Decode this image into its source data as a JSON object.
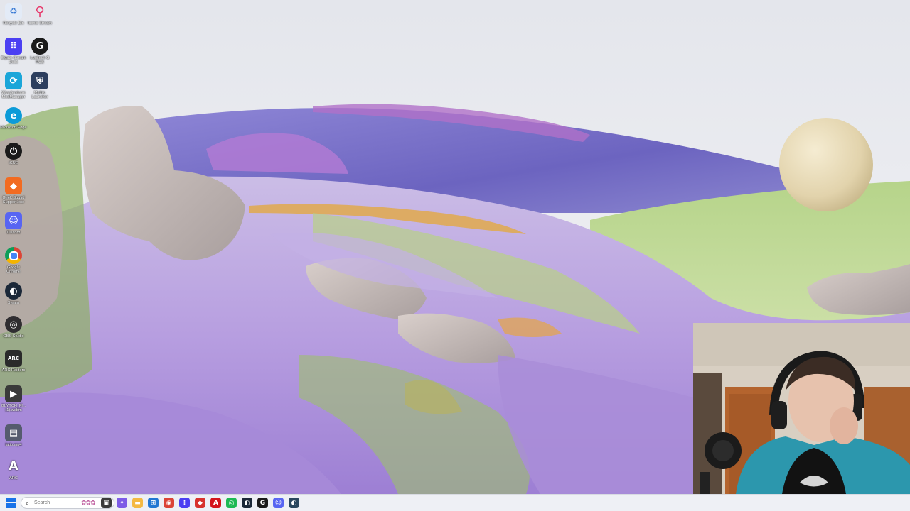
{
  "desktop_icons": [
    {
      "label": "Recycle Bin",
      "icon": "recycle-bin-icon",
      "color": "#dfe8f5"
    },
    {
      "label": "Iconic Stream",
      "icon": "map-pin-icon",
      "color": "#ffffff"
    },
    {
      "label": "Elgato Stream Deck",
      "icon": "stream-deck-icon",
      "color": "#4b3ff2"
    },
    {
      "label": "Logitech G HUB",
      "icon": "logitech-g-icon",
      "color": "#1b1b1b"
    },
    {
      "label": "Wondershare ModManager",
      "icon": "mod-manager-icon",
      "color": "#1ba6d9"
    },
    {
      "label": "Mythic Launcher",
      "icon": "shield-icon",
      "color": "#2c3e5e"
    },
    {
      "label": "Microsoft Edge",
      "icon": "edge-icon",
      "color": "#0c9bd8"
    },
    {
      "label": "iCUE",
      "icon": "icue-icon",
      "color": "#1a1a1a"
    },
    {
      "label": "Geek Squad Support.exe",
      "icon": "geek-squad-icon",
      "color": "#f26b21"
    },
    {
      "label": "Discord",
      "icon": "discord-icon",
      "color": "#5865f2"
    },
    {
      "label": "Google Chrome",
      "icon": "chrome-icon",
      "color": "#db4437"
    },
    {
      "label": "Steam",
      "icon": "steam-icon",
      "color": "#1b2838"
    },
    {
      "label": "OBS Studio",
      "icon": "obs-icon",
      "color": "#302e31"
    },
    {
      "label": "ARC Raiders",
      "icon": "arc-raiders-icon",
      "color": "#2a2a2a"
    },
    {
      "label": "GLYTCH_Fl... (1).webm",
      "icon": "video-file-icon",
      "color": "#3a3a3a"
    },
    {
      "label": "fatio.mp4",
      "icon": "mp4-file-icon",
      "color": "#555b6e"
    },
    {
      "label": "ARC",
      "icon": "arc-letter-icon",
      "color": "#3b3b3b"
    }
  ],
  "taskbar": {
    "search_placeholder": "Search",
    "apps": [
      {
        "name": "task-view",
        "icon": "task-view-icon",
        "color": "#3b3b3b",
        "glyph": "▣"
      },
      {
        "name": "copilot",
        "icon": "copilot-icon",
        "color": "#7d5ce6",
        "glyph": "✦"
      },
      {
        "name": "file-explorer",
        "icon": "folder-icon",
        "color": "#f4b942",
        "glyph": "▬"
      },
      {
        "name": "microsoft-store",
        "icon": "store-icon",
        "color": "#2176d2",
        "glyph": "⊞"
      },
      {
        "name": "chrome",
        "icon": "chrome-icon",
        "color": "#db4437",
        "glyph": "◉"
      },
      {
        "name": "stream-deck",
        "icon": "stream-deck-icon",
        "color": "#4b3ff2",
        "glyph": "⁞"
      },
      {
        "name": "geek-squad",
        "icon": "geek-squad-icon",
        "color": "#d7322c",
        "glyph": "◆"
      },
      {
        "name": "adobe",
        "icon": "adobe-icon",
        "color": "#d4141c",
        "glyph": "A"
      },
      {
        "name": "spotify",
        "icon": "spotify-icon",
        "color": "#1db954",
        "glyph": "◎"
      },
      {
        "name": "steam",
        "icon": "steam-icon",
        "color": "#1b2838",
        "glyph": "◐"
      },
      {
        "name": "logitech",
        "icon": "logitech-g-icon",
        "color": "#1b1b1b",
        "glyph": "G"
      },
      {
        "name": "discord",
        "icon": "discord-icon",
        "color": "#5865f2",
        "glyph": "☺"
      },
      {
        "name": "steam-2",
        "icon": "steam-icon",
        "color": "#2a475e",
        "glyph": "◐"
      }
    ]
  }
}
